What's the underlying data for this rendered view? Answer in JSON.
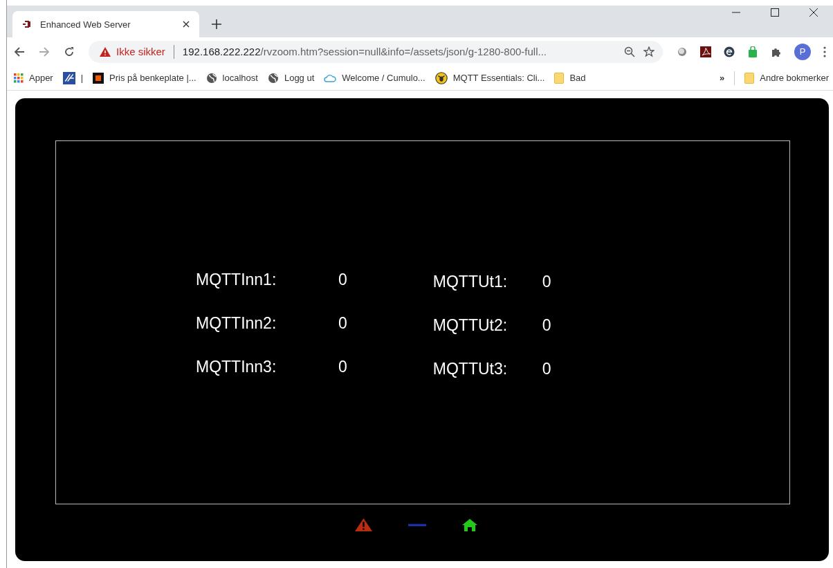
{
  "tabs": [
    {
      "label": "Enhanced Web Server",
      "selected": true
    }
  ],
  "address_bar": {
    "security": "Ikke sikker",
    "url_host": "192.168.222.222",
    "url_path": "/rvzoom.htm?session=null&info=/assets/json/g-1280-800-full..."
  },
  "bookmarks": [
    {
      "kind": "apps",
      "label": "Apper"
    },
    {
      "kind": "site",
      "label": "|"
    },
    {
      "kind": "square",
      "label": "Pris på benkeplate |..."
    },
    {
      "kind": "globe",
      "label": "localhost"
    },
    {
      "kind": "globe",
      "label": "Logg ut"
    },
    {
      "kind": "cloud",
      "label": "Welcome / Cumulo..."
    },
    {
      "kind": "mqtt",
      "label": "MQTT Essentials: Cli..."
    },
    {
      "kind": "folder",
      "label": "Bad"
    }
  ],
  "bookmarks_overflow": "»",
  "other_bookmarks": "Andre bokmerker",
  "profile_initial": "P",
  "inputs": [
    {
      "label": "MQTTInn1:",
      "value": "0"
    },
    {
      "label": "MQTTInn2:",
      "value": "0"
    },
    {
      "label": "MQTTInn3:",
      "value": "0"
    }
  ],
  "outputs": [
    {
      "label": "MQTTUt1:",
      "value": "0"
    },
    {
      "label": "MQTTUt2:",
      "value": "0"
    },
    {
      "label": "MQTTUt3:",
      "value": "0"
    }
  ]
}
